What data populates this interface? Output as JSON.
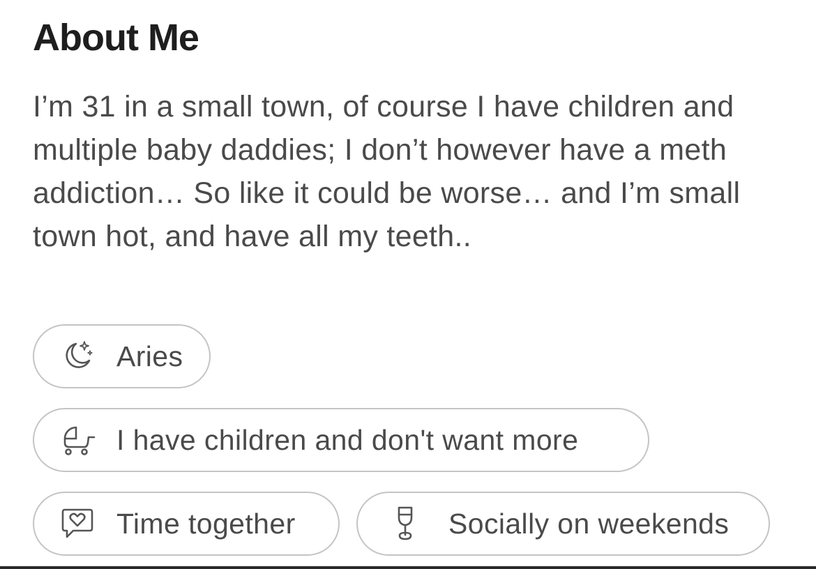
{
  "section": {
    "title": "About Me",
    "bio": "I’m 31 in a small town, of course I have children and multiple baby daddies; I don’t however have a meth addiction… So like it could be worse… and I’m small town hot, and have all my teeth.."
  },
  "chips": {
    "zodiac": {
      "icon": "moon-stars-icon",
      "label": "Aries"
    },
    "children": {
      "icon": "stroller-icon",
      "label": "I have children and don't want more"
    },
    "love_language": {
      "icon": "heart-chat-icon",
      "label": "Time together"
    },
    "drinking": {
      "icon": "wine-glass-icon",
      "label": "Socially on weekends"
    }
  },
  "colors": {
    "title": "#1e1e1e",
    "text": "#4a4a4a",
    "chip_border": "#c4c4c4",
    "icon_stroke": "#555555"
  }
}
